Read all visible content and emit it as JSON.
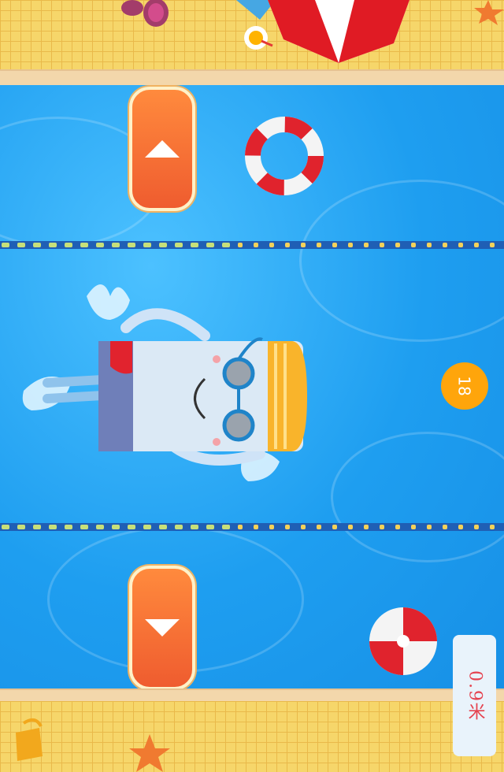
{
  "hud": {
    "score": "18",
    "distance": "0.9米"
  },
  "controls": {
    "up_icon": "arrow-up-icon",
    "down_icon": "arrow-down-icon"
  },
  "colors": {
    "water": "#1e9ef0",
    "deck": "#f6d66a",
    "button": "#ef5c2f",
    "coin": "#ffa50b",
    "distance_text": "#e5424f"
  }
}
